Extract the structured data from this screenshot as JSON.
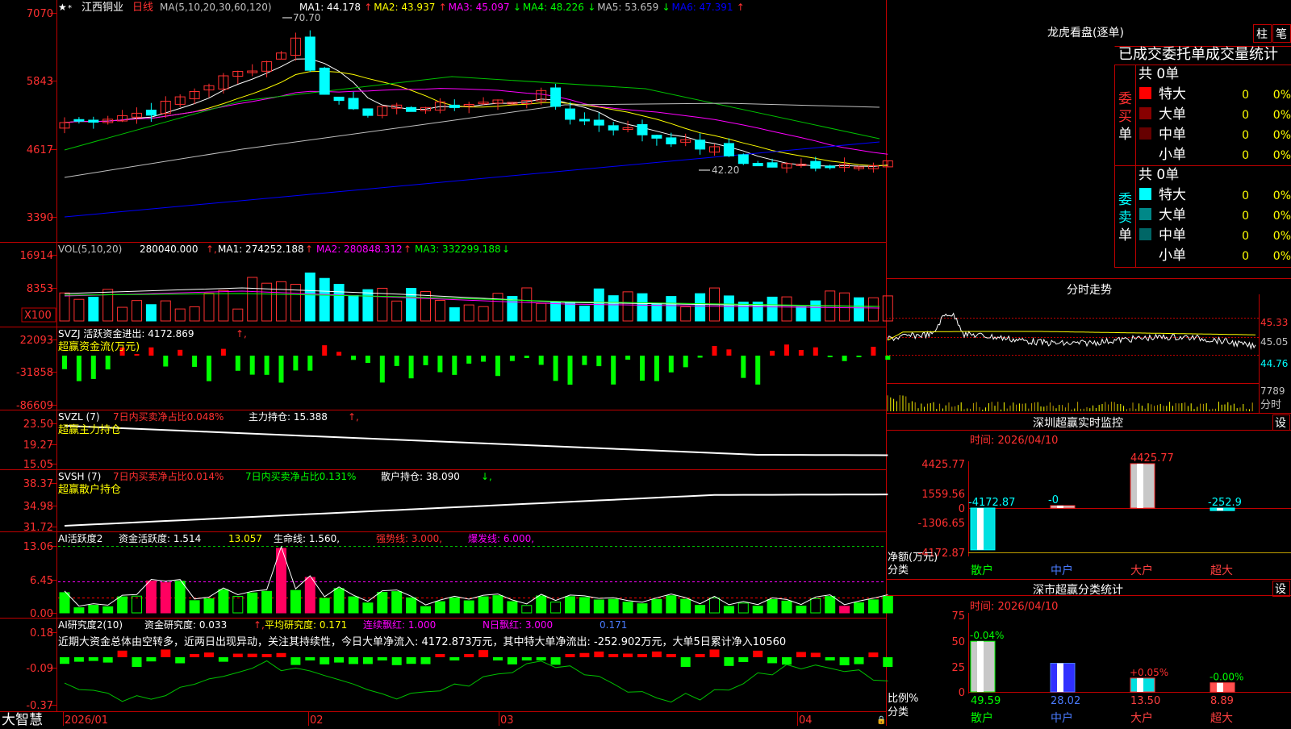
{
  "app": {
    "brand": "大智慧",
    "stock_name": "江西铜业",
    "period": "日线"
  },
  "main_panel": {
    "ma_params": "MA(5,10,20,30,60,120)",
    "ma": [
      {
        "label": "MA1: 44.178",
        "arrow": "↑",
        "color": "#ffffff"
      },
      {
        "label": "MA2: 43.937",
        "arrow": "↑",
        "color": "#ffff00"
      },
      {
        "label": "MA3: 45.097",
        "arrow": "↓",
        "color": "#ff00ff"
      },
      {
        "label": "MA4: 48.226",
        "arrow": "↓",
        "color": "#00ff00"
      },
      {
        "label": "MA5: 53.659",
        "arrow": "↓",
        "color": "#c0c0c0"
      },
      {
        "label": "MA6: 47.391",
        "arrow": "↑",
        "color": "#0000ff"
      }
    ],
    "y_ticks": [
      "7070",
      "5843",
      "4617",
      "3390"
    ],
    "high_label": "70.70",
    "low_label": "42.20"
  },
  "vol_panel": {
    "title": "VOL(5,10,20)",
    "value": "280040.000",
    "ma": [
      {
        "label": "MA1: 274252.188",
        "arrow": "↑",
        "color": "#ffffff"
      },
      {
        "label": "MA2: 280848.312",
        "arrow": "↑",
        "color": "#ff00ff"
      },
      {
        "label": "MA3: 332299.188",
        "arrow": "↓",
        "color": "#00ff00"
      }
    ],
    "y_ticks": [
      "16914",
      "8353"
    ],
    "unit": "X100"
  },
  "svzj_panel": {
    "title": "SVZJ  活跃资金进出: 4172.869",
    "arrow": "↑,",
    "subtitle": "超赢资金流(万元)",
    "y_ticks": [
      "22093",
      "-31858",
      "-86609"
    ]
  },
  "svzl_panel": {
    "title": "SVZL (7)",
    "t1": "7日内买卖净占比0.048%",
    "t2": "主力持仓: 15.388",
    "arrow": "↑,",
    "subtitle": "超赢主力持仓",
    "y_ticks": [
      "23.50",
      "19.27",
      "15.05"
    ]
  },
  "svsh_panel": {
    "title": "SVSH (7)",
    "t1": "7日内买卖净占比0.014%",
    "t2": "7日内买卖净占比0.131%",
    "t3": "散户持仓: 38.090",
    "arrow": "↓,",
    "subtitle": "超赢散户持仓",
    "y_ticks": [
      "38.37",
      "34.98",
      "31.72"
    ]
  },
  "ai_active_panel": {
    "title": "AI活跃度2",
    "t1": "资金活跃度: 1.514",
    "t2": "13.057",
    "t3": "生命线: 1.560,",
    "t4": "强势线: 3.000,",
    "t5": "爆发线: 6.000,",
    "y_ticks": [
      "13.06",
      "6.45",
      "0.00"
    ]
  },
  "ai_research_panel": {
    "title": "AI研究度2(10)",
    "t1": "资金研究度: 0.033",
    "t2": "平均研究度: 0.171",
    "t3": "连续飘红: 1.000",
    "t4": "N日飘红: 3.000",
    "t5": "0.171",
    "comment": "近期大资金总体由空转多，近两日出现异动，关注其持续性，今日大单净流入: 4172.873万元，其中特大单净流出: -252.902万元，大单5日累计净入10560",
    "y_ticks": [
      "0.18",
      "-0.09",
      "-0.37"
    ]
  },
  "x_axis": [
    "2026/01",
    "02",
    "03",
    "04"
  ],
  "right": {
    "lhb_title": "龙虎看盘(逐单)",
    "btn_zhu": "柱",
    "btn_bi": "笔",
    "table_title": "已成交委托单成交量统计",
    "buy_side": "委买单",
    "sell_side": "委卖单",
    "buy_total": "共 0单",
    "sell_total": "共 0单",
    "buy_rows": [
      {
        "name": "特大",
        "count": "0",
        "pct": "0%",
        "color": "#ff0000"
      },
      {
        "name": "大单",
        "count": "0",
        "pct": "0%",
        "color": "#880000"
      },
      {
        "name": "中单",
        "count": "0",
        "pct": "0%",
        "color": "#660000"
      },
      {
        "name": "小单",
        "count": "0",
        "pct": "0%",
        "color": "#000000"
      }
    ],
    "sell_rows": [
      {
        "name": "特大",
        "count": "0",
        "pct": "0%",
        "color": "#00ffff"
      },
      {
        "name": "大单",
        "count": "0",
        "pct": "0%",
        "color": "#008888"
      },
      {
        "name": "中单",
        "count": "0",
        "pct": "0%",
        "color": "#006666"
      },
      {
        "name": "小单",
        "count": "0",
        "pct": "0%",
        "color": "#000000"
      }
    ],
    "fenshi_title": "分时走势",
    "fenshi_prices": [
      "45.33",
      "45.05",
      "44.76"
    ],
    "fenshi_vol": "7789",
    "fenshi_unit": "分时",
    "monitor_title": "深圳超赢实时监控",
    "monitor_btn": "设",
    "monitor_time": "时间: 2026/04/10",
    "monitor_y": [
      "4425.77",
      "1559.56",
      "0",
      "-1306.65",
      "-4172.87"
    ],
    "monitor_ylabel": "净额(万元)",
    "monitor_xlabel": "分类",
    "monitor_bars": [
      {
        "cat": "散户",
        "label": "-4172.87",
        "value": -4172.87,
        "cat_color": "#00ff00"
      },
      {
        "cat": "中户",
        "label": "-0",
        "value": 0,
        "cat_color": "#4a7bff"
      },
      {
        "cat": "大户",
        "label": "4425.77",
        "value": 4425.77,
        "cat_color": "#ff4040"
      },
      {
        "cat": "超大",
        "label": "-252.9",
        "value": -252.9,
        "cat_color": "#ff4040"
      }
    ],
    "class_title": "深市超赢分类统计",
    "class_btn": "设",
    "class_time": "时间: 2026/04/10",
    "class_y": [
      "75",
      "50",
      "25",
      "0"
    ],
    "class_ylabel": "比例%",
    "class_xlabel": "分类",
    "class_bars": [
      {
        "cat": "散户",
        "value": 49.59,
        "label": "49.59",
        "change": "-0.04%",
        "cat_color": "#00ff00"
      },
      {
        "cat": "中户",
        "value": 28.02,
        "label": "28.02",
        "change": "",
        "cat_color": "#4a7bff"
      },
      {
        "cat": "大户",
        "value": 13.5,
        "label": "13.50",
        "change": "+0.05%",
        "cat_color": "#ff4040"
      },
      {
        "cat": "超大",
        "value": 8.89,
        "label": "8.89",
        "change": "-0.00%",
        "cat_color": "#ff4040"
      }
    ]
  }
}
